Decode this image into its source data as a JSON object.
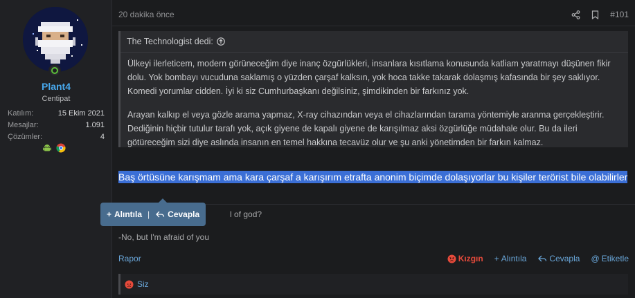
{
  "user": {
    "name": "Plant4",
    "title": "Centipat",
    "stats": [
      {
        "label": "Katılım:",
        "value": "15 Ekim 2021"
      },
      {
        "label": "Mesajlar:",
        "value": "1.091"
      },
      {
        "label": "Çözümler:",
        "value": "4"
      }
    ],
    "badges": [
      "android-icon",
      "chrome-icon"
    ],
    "online": true
  },
  "post": {
    "time": "20 dakika önce",
    "number": "#101",
    "header_icons": [
      "share-icon",
      "bookmark-icon"
    ],
    "quote": {
      "author_line": "The Technologist dedi:",
      "paragraphs": [
        "Ülkeyi ilerleticem, modern görüneceğim diye inanç özgürlükleri, insanlara kısıtlama konusunda katliam yaratmayı düşünen fikir dolu. Yok bombayı vucuduna saklamış o yüzden çarşaf kalksın, yok hoca takke takarak dolaşmış kafasında bir şey saklıyor. Komedi yorumlar cidden. İyi ki siz Cumhurbaşkanı değilsiniz, şimdikinden bir farkınız yok.",
        "Arayan kalkıp el veya gözle arama yapmaz, X-ray cihazından veya el cihazlarından tarama yöntemiyle aranma gerçekleştirir. Dediğinin hiçbir tutulur tarafı yok, açık giyene de kapalı giyene de karışılmaz aksi özgürlüğe müdahale olur. Bu da ileri götüreceğim sizi diye aslında insanın en temel hakkına tecavüz olur ve şu anki yönetimden bir farkın kalmaz."
      ]
    },
    "selected_text": "Baş örtüsüne karışmam ama kara çarşaf a karışırım etrafta anonim biçimde dolaşıyorlar bu kişiler terörist bile olabilirler",
    "body_line1_visible": "l of god?",
    "body_line2": "-No, but I'm afraid of you"
  },
  "tooltip": {
    "quote_label": "Alıntıla",
    "separator": "|",
    "reply_label": "Cevapla"
  },
  "footer": {
    "report": "Rapor",
    "angry": "Kızgın",
    "quote": "Alıntıla",
    "reply": "Cevapla",
    "tag": "Etiketle"
  },
  "reactions": {
    "text": "Siz"
  },
  "colors": {
    "username": "#47a7eb",
    "link": "#6aa7da",
    "angry": "#e64a3b",
    "selection": "#3b6fd6",
    "tooltip": "#486c8e"
  }
}
